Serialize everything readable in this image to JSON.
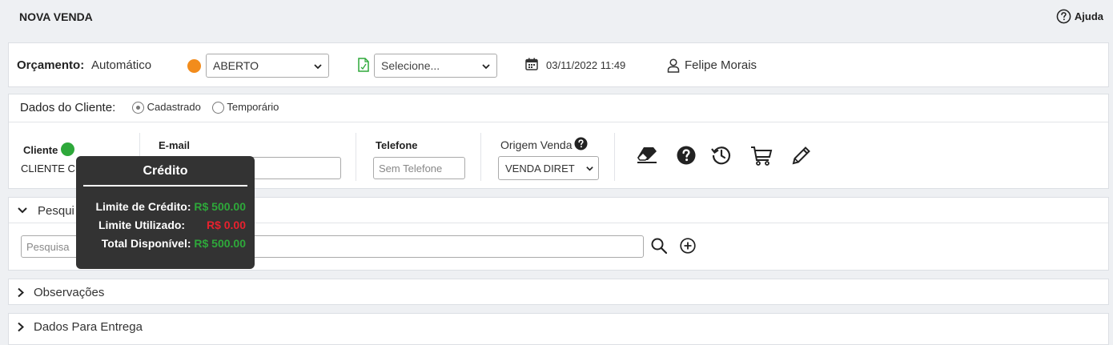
{
  "header": {
    "title": "NOVA VENDA",
    "help_label": "Ajuda"
  },
  "budget": {
    "label": "Orçamento:",
    "value": "Automático",
    "status_color": "#f28c1c",
    "status_select": "ABERTO",
    "document_select": "Selecione...",
    "datetime": "03/11/2022 11:49",
    "user": "Felipe Morais"
  },
  "client_data": {
    "label": "Dados do Cliente:",
    "option_registered": "Cadastrado",
    "option_temporary": "Temporário"
  },
  "client": {
    "label": "Cliente",
    "status_color": "#2ea83a",
    "name_visible": "CLIENTE CL",
    "email_label": "E-mail",
    "phone_label": "Telefone",
    "phone_placeholder": "Sem Telefone",
    "origin_label": "Origem Venda",
    "origin_select": "VENDA DIRET"
  },
  "search_section": {
    "title_visible": "Pesqui",
    "input_placeholder_visible": "Pesquisa"
  },
  "sections": {
    "notes": "Observações",
    "delivery": "Dados Para Entrega"
  },
  "credit_tooltip": {
    "title": "Crédito",
    "limit_label": "Limite de Crédito:",
    "limit_value": "R$ 500.00",
    "used_label": "Limite Utilizado:",
    "used_value": "R$ 0.00",
    "available_label": "Total Disponível:",
    "available_value": "R$ 500.00"
  },
  "colors": {
    "positive": "#2ea83a",
    "negative": "#e8212e",
    "tooltip_bg": "#333333"
  }
}
